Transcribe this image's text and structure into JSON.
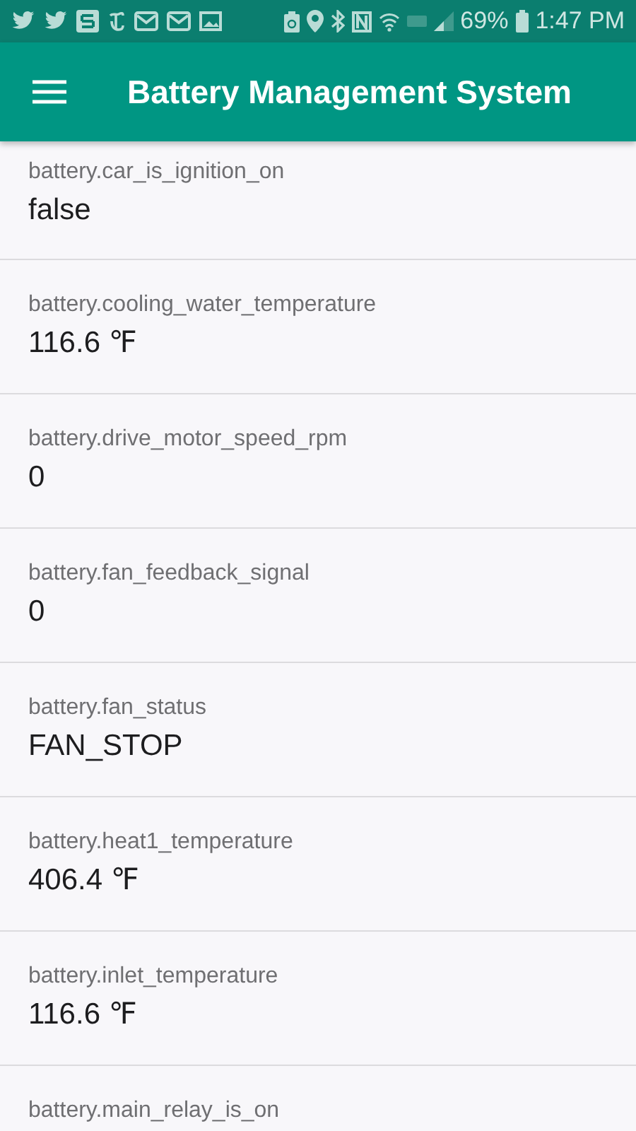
{
  "status_bar": {
    "notification_icons": [
      {
        "kind": "bird"
      },
      {
        "kind": "bird"
      },
      {
        "kind": "square"
      },
      {
        "kind": "newspaper"
      },
      {
        "kind": "mail"
      },
      {
        "kind": "mail"
      },
      {
        "kind": "image"
      }
    ],
    "system_icons": [
      {
        "kind": "saver"
      },
      {
        "kind": "location"
      },
      {
        "kind": "bluetooth"
      },
      {
        "kind": "nfc"
      },
      {
        "kind": "wifi"
      },
      {
        "kind": "lte"
      },
      {
        "kind": "signal"
      }
    ],
    "battery_percent": "69%",
    "time": "1:47 PM"
  },
  "app_bar": {
    "title": "Battery Management System"
  },
  "items": [
    {
      "label": "battery.car_is_ignition_on",
      "value": "false"
    },
    {
      "label": "battery.cooling_water_temperature",
      "value": "116.6 ℉"
    },
    {
      "label": "battery.drive_motor_speed_rpm",
      "value": "0"
    },
    {
      "label": "battery.fan_feedback_signal",
      "value": "0"
    },
    {
      "label": "battery.fan_status",
      "value": "FAN_STOP"
    },
    {
      "label": "battery.heat1_temperature",
      "value": "406.4 ℉"
    },
    {
      "label": "battery.inlet_temperature",
      "value": "116.6 ℉"
    },
    {
      "label": "battery.main_relay_is_on"
    }
  ]
}
